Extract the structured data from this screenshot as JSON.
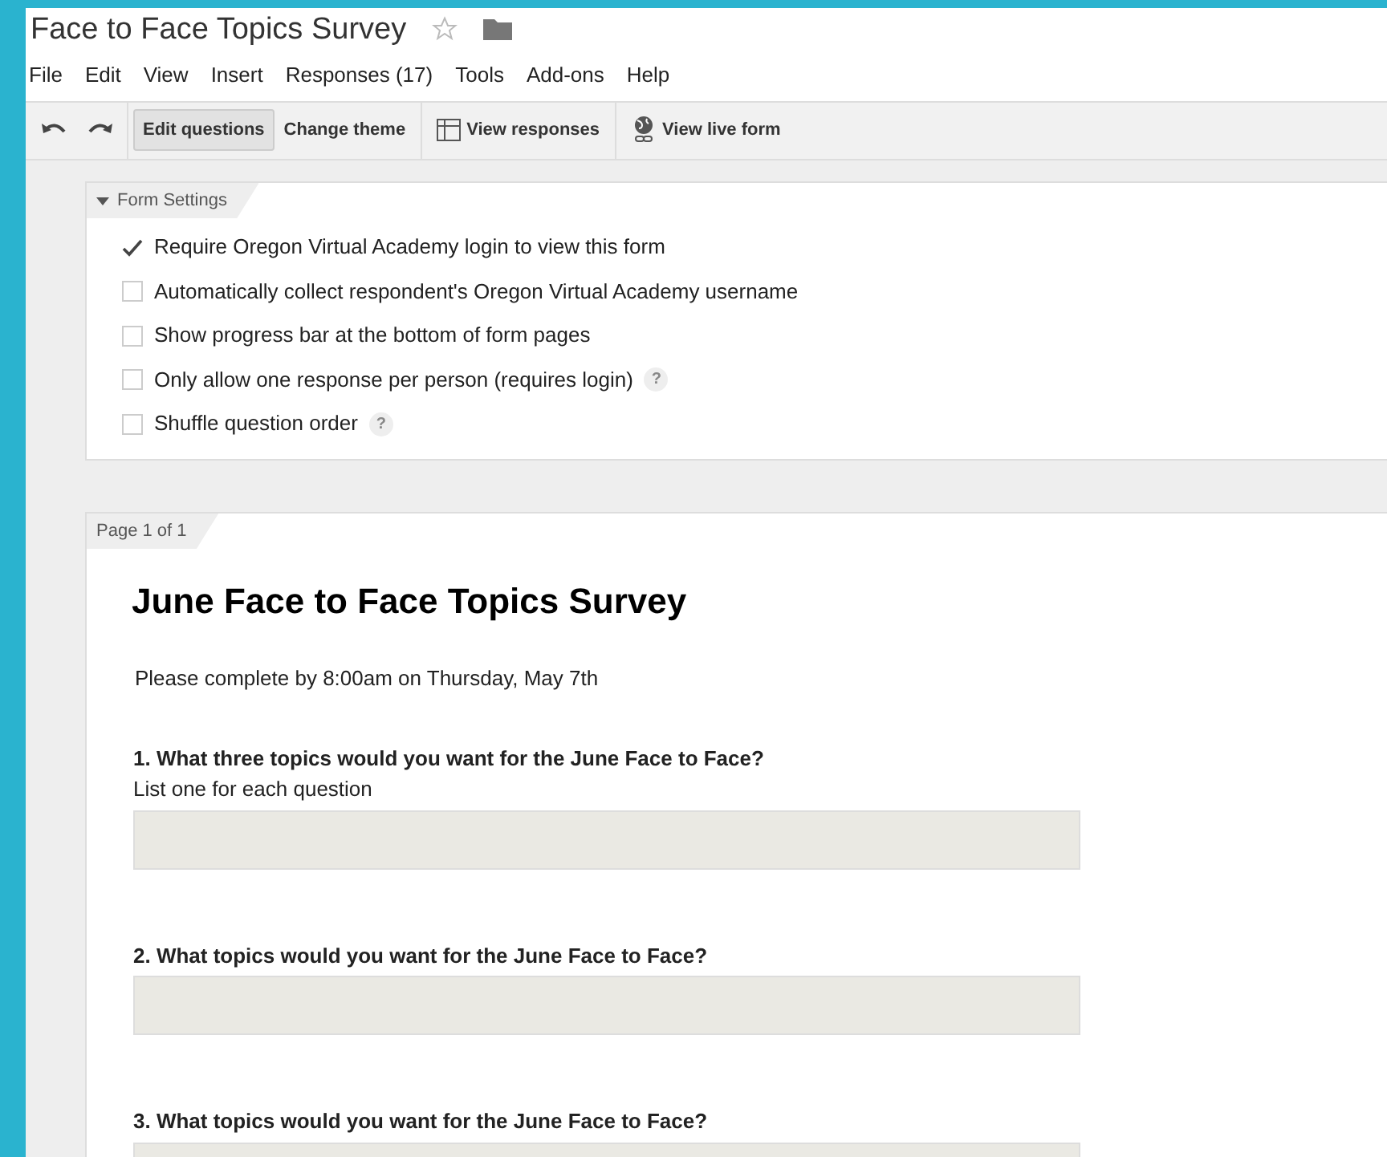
{
  "doc_title": "Face to Face Topics Survey",
  "starred": false,
  "menu": [
    "File",
    "Edit",
    "View",
    "Insert",
    "Responses (17)",
    "Tools",
    "Add-ons",
    "Help"
  ],
  "toolbar": [
    {
      "kind": "undo"
    },
    {
      "kind": "redo"
    },
    {
      "kind": "button",
      "label": "Edit questions",
      "selected": true
    },
    {
      "kind": "button",
      "label": "Change theme",
      "selected": false
    },
    {
      "kind": "table",
      "label": "View responses",
      "selected": false
    },
    {
      "kind": "globe",
      "label": "View live form",
      "selected": false
    }
  ],
  "settings": {
    "title": "Form Settings",
    "expanded": true,
    "options": [
      {
        "label": "Require Oregon Virtual Academy login to view this form",
        "checked": true
      },
      {
        "label": "Automatically collect respondent's Oregon Virtual Academy username",
        "checked": false
      },
      {
        "label": "Show progress bar at the bottom of form pages",
        "checked": false
      },
      {
        "label": "Only allow one response per person (requires login)",
        "checked": false,
        "help": "?"
      },
      {
        "label": "Shuffle question order",
        "checked": false,
        "help": "?"
      }
    ]
  },
  "page": {
    "tab": "Page 1 of 1",
    "title": "June Face to Face Topics Survey",
    "description": "Please complete by 8:00am on Thursday, May 7th",
    "questions": [
      {
        "title": "1. What three topics would you want for the June Face to Face?",
        "help_text": "List one for each question"
      },
      {
        "title": "2. What topics would you want for the June Face to Face?"
      },
      {
        "title": "3. What topics would you want for the June Face to Face?"
      }
    ]
  }
}
